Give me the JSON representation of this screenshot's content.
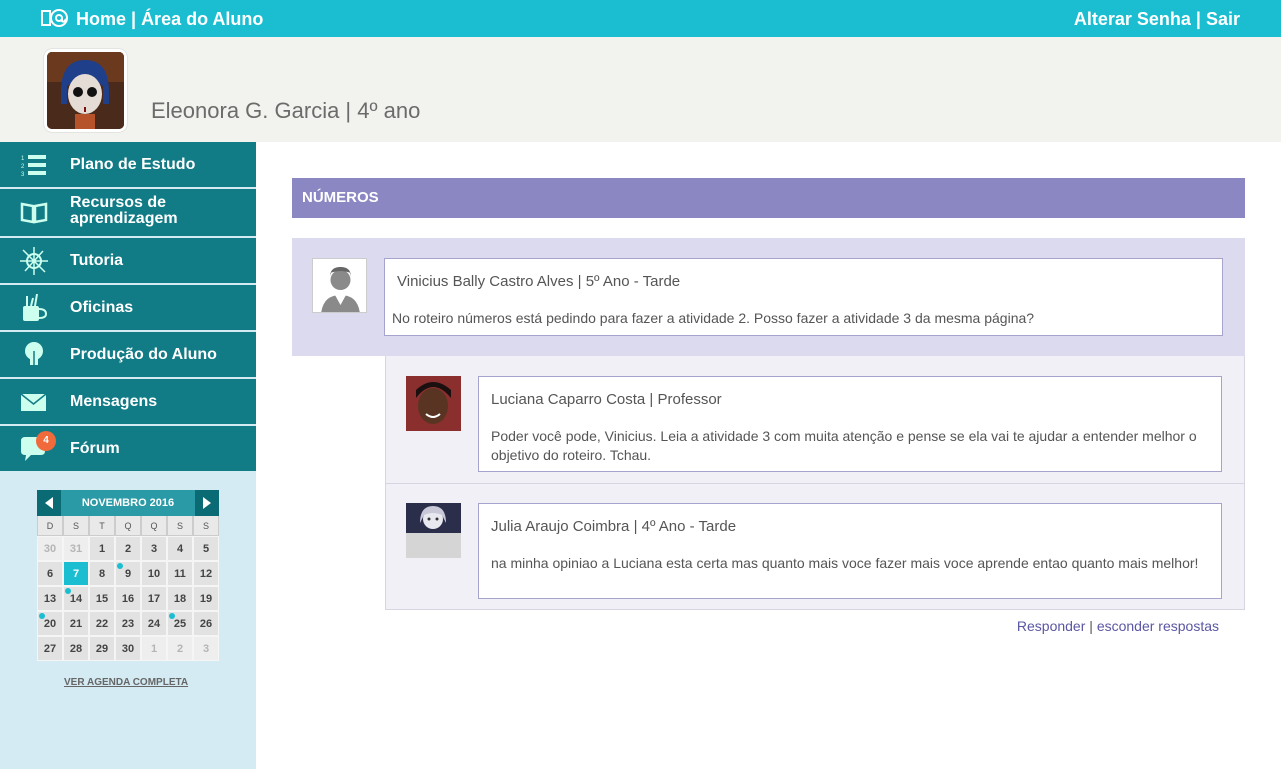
{
  "topbar": {
    "logo_icon": "at-sign-envelope-icon",
    "home": "Home",
    "separator": " | ",
    "area": "Área do Aluno",
    "change_password": "Alterar Senha",
    "logout": "Sair"
  },
  "profile": {
    "name": "Eleonora G. Garcia | 4º ano"
  },
  "sidebar": {
    "items": [
      {
        "label": "Plano de Estudo",
        "icon": "numbered-list-icon"
      },
      {
        "label": "Recursos de aprendizagem",
        "icon": "open-book-icon"
      },
      {
        "label": "Tutoria",
        "icon": "compass-icon"
      },
      {
        "label": "Oficinas",
        "icon": "cup-tools-icon"
      },
      {
        "label": "Produção do Aluno",
        "icon": "lightbulb-icon"
      },
      {
        "label": "Mensagens",
        "icon": "envelope-icon"
      },
      {
        "label": "Fórum",
        "icon": "speech-bubble-icon",
        "badge": "4"
      }
    ]
  },
  "calendar": {
    "title": "NOVEMBRO 2016",
    "weekdays": [
      "D",
      "S",
      "T",
      "Q",
      "Q",
      "S",
      "S"
    ],
    "days": [
      {
        "d": "30",
        "muted": true
      },
      {
        "d": "31",
        "muted": true
      },
      {
        "d": "1"
      },
      {
        "d": "2"
      },
      {
        "d": "3"
      },
      {
        "d": "4"
      },
      {
        "d": "5"
      },
      {
        "d": "6"
      },
      {
        "d": "7",
        "today": true
      },
      {
        "d": "8"
      },
      {
        "d": "9",
        "marked": true
      },
      {
        "d": "10"
      },
      {
        "d": "11"
      },
      {
        "d": "12"
      },
      {
        "d": "13"
      },
      {
        "d": "14",
        "marked": true
      },
      {
        "d": "15"
      },
      {
        "d": "16"
      },
      {
        "d": "17"
      },
      {
        "d": "18"
      },
      {
        "d": "19"
      },
      {
        "d": "20",
        "marked": true
      },
      {
        "d": "21"
      },
      {
        "d": "22"
      },
      {
        "d": "23"
      },
      {
        "d": "24"
      },
      {
        "d": "25",
        "marked": true
      },
      {
        "d": "26"
      },
      {
        "d": "27"
      },
      {
        "d": "28"
      },
      {
        "d": "29"
      },
      {
        "d": "30"
      },
      {
        "d": "1",
        "muted": true
      },
      {
        "d": "2",
        "muted": true
      },
      {
        "d": "3",
        "muted": true
      }
    ],
    "agenda_link": "VER AGENDA COMPLETA"
  },
  "forum": {
    "topic": "NÚMEROS",
    "question": {
      "author": "Vinicius Bally Castro Alves | 5º Ano - Tarde",
      "text": "No roteiro números está pedindo para fazer a atividade 2. Posso fazer a atividade 3 da mesma página?"
    },
    "replies": [
      {
        "author": "Luciana Caparro Costa | Professor",
        "text": "Poder você pode, Vinicius. Leia a atividade 3 com muita atenção e pense se ela vai te ajudar a entender melhor o objetivo do roteiro. Tchau."
      },
      {
        "author": "Julia Araujo Coimbra | 4º Ano - Tarde",
        "text": "na minha opiniao a Luciana esta certa mas quanto mais voce fazer mais voce aprende entao quanto mais melhor!"
      }
    ],
    "reply_link": "Responder",
    "hide_link": "esconder respostas",
    "link_separator": " | "
  },
  "colors": {
    "topbar": "#1bbed1",
    "sidebar_item": "#117b86",
    "topic_header": "#8a87c3",
    "badge": "#f06a3b"
  }
}
